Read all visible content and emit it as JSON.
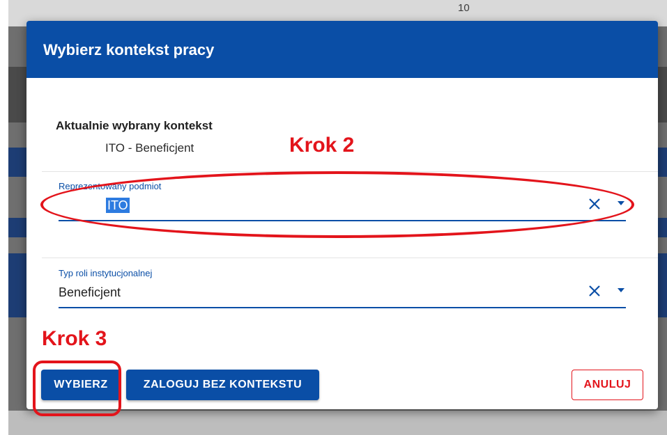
{
  "background": {
    "column_number": "10"
  },
  "dialog": {
    "title": "Wybierz kontekst pracy",
    "current_context": {
      "label": "Aktualnie wybrany kontekst",
      "value": "ITO - Beneficjent"
    },
    "fields": [
      {
        "label": "Reprezentowany podmiot",
        "value": "ITO",
        "clear_icon": "close-icon",
        "dropdown_icon": "arrow-drop-down-icon"
      },
      {
        "label": "Typ roli instytucjonalnej",
        "value": "Beneficjent",
        "clear_icon": "close-icon",
        "dropdown_icon": "arrow-drop-down-icon"
      }
    ],
    "buttons": {
      "select": "WYBIERZ",
      "login_without_context": "ZALOGUJ BEZ KONTEKSTU",
      "cancel": "ANULUJ"
    }
  },
  "annotations": {
    "step2": "Krok 2",
    "step3": "Krok 3",
    "color": "#e3141b"
  },
  "colors": {
    "primary": "#0a4ea6",
    "danger": "#e3141b"
  }
}
